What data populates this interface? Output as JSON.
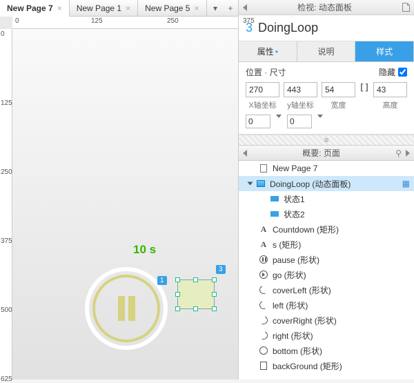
{
  "tabs": [
    {
      "label": "New Page 7",
      "active": true
    },
    {
      "label": "New Page 1",
      "active": false
    },
    {
      "label": "New Page 5",
      "active": false
    }
  ],
  "ruler_h": [
    "0",
    "125",
    "250",
    "375"
  ],
  "ruler_v": [
    "0",
    "125",
    "250",
    "375",
    "500",
    "625"
  ],
  "canvas": {
    "countdown_text": "10 s",
    "badge_left": "1",
    "badge_right": "3"
  },
  "inspect": {
    "panel_title": "检视: 动态面板",
    "index": "3",
    "name": "DoingLoop",
    "tabs": {
      "props": "属性",
      "notes": "说明",
      "style": "样式"
    },
    "pos_label": "位置 · 尺寸",
    "hide_label": "隐藏",
    "x": "270",
    "y": "443",
    "w": "54",
    "h": "43",
    "xl": "X轴坐标",
    "yl": "y轴坐标",
    "wl": "宽度",
    "hl": "高度",
    "rot1": "0",
    "rot2": "0"
  },
  "outline": {
    "panel_title": "概要: 页面",
    "items": [
      {
        "depth": 0,
        "icon": "page",
        "label": "New Page 7",
        "tw": "none"
      },
      {
        "depth": 0,
        "icon": "dp",
        "label": "DoingLoop (动态面板)",
        "tw": "open",
        "sel": true,
        "end": "▦"
      },
      {
        "depth": 1,
        "icon": "state",
        "label": "状态1",
        "tw": "none"
      },
      {
        "depth": 1,
        "icon": "state",
        "label": "状态2",
        "tw": "none"
      },
      {
        "depth": 0,
        "icon": "A",
        "label": "Countdown (矩形)",
        "tw": "none"
      },
      {
        "depth": 0,
        "icon": "A",
        "label": "s (矩形)",
        "tw": "none"
      },
      {
        "depth": 0,
        "icon": "pause",
        "label": "pause (形状)",
        "tw": "none"
      },
      {
        "depth": 0,
        "icon": "play",
        "label": "go (形状)",
        "tw": "none"
      },
      {
        "depth": 0,
        "icon": "arc-l",
        "label": "coverLeft (形状)",
        "tw": "none"
      },
      {
        "depth": 0,
        "icon": "arc-l",
        "label": "left (形状)",
        "tw": "none"
      },
      {
        "depth": 0,
        "icon": "arc-r",
        "label": "coverRight (形状)",
        "tw": "none"
      },
      {
        "depth": 0,
        "icon": "arc-r",
        "label": "right (形状)",
        "tw": "none"
      },
      {
        "depth": 0,
        "icon": "circ",
        "label": "bottom (形状)",
        "tw": "none"
      },
      {
        "depth": 0,
        "icon": "rect",
        "label": "backGround (矩形)",
        "tw": "none"
      }
    ]
  }
}
